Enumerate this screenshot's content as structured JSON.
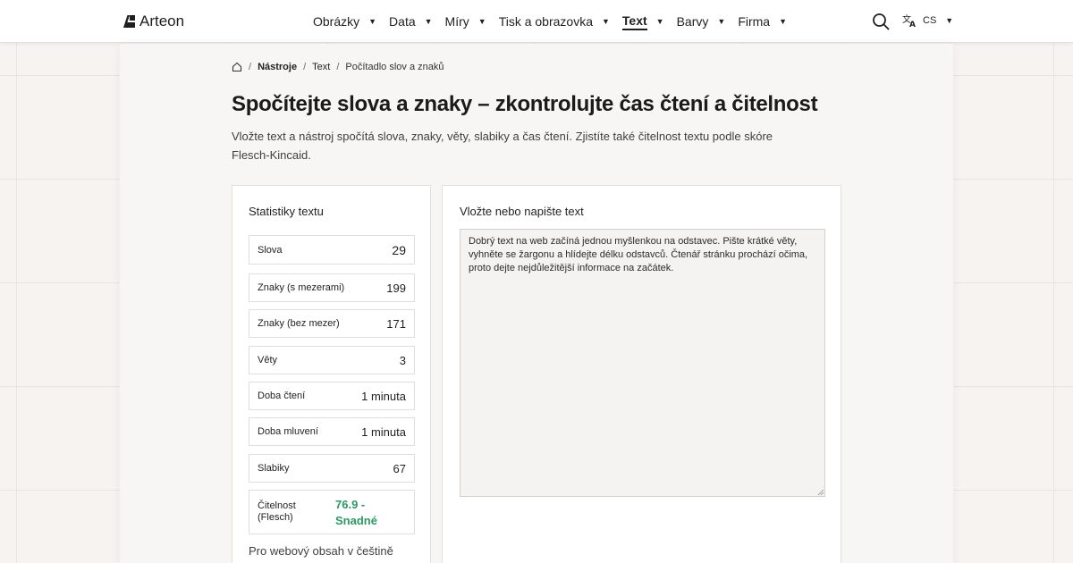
{
  "header": {
    "brand": "Arteon",
    "nav": [
      {
        "label": "Obrázky",
        "active": false
      },
      {
        "label": "Data",
        "active": false
      },
      {
        "label": "Míry",
        "active": false
      },
      {
        "label": "Tisk a obrazovka",
        "active": false
      },
      {
        "label": "Text",
        "active": true
      },
      {
        "label": "Barvy",
        "active": false
      },
      {
        "label": "Firma",
        "active": false
      }
    ],
    "caret": "▼",
    "search_icon": "search-icon",
    "language": {
      "icon": "translate-icon",
      "code": "CS"
    }
  },
  "breadcrumb": {
    "home_icon": "home-icon",
    "separator": "/",
    "items": [
      "Nástroje",
      "Text",
      "Počítadlo slov a znaků"
    ]
  },
  "page": {
    "title": "Spočítejte slova a znaky – zkontrolujte čas čtení a čitelnost",
    "description": "Vložte text a nástroj spočítá slova, znaky, věty, slabiky a čas čtení. Zjistíte také čitelnost textu podle skóre Flesch-Kincaid."
  },
  "stats": {
    "heading": "Statistiky textu",
    "rows": [
      {
        "label": "Slova",
        "value": "29"
      },
      {
        "label": "Znaky (s mezerami)",
        "value": "199"
      },
      {
        "label": "Znaky (bez mezer)",
        "value": "171"
      },
      {
        "label": "Věty",
        "value": "3"
      },
      {
        "label": "Doba čtení",
        "value": "1 minuta"
      },
      {
        "label": "Doba mluvení",
        "value": "1 minuta"
      },
      {
        "label": "Slabiky",
        "value": "67"
      }
    ],
    "readability": {
      "label": "Čitelnost (Flesch)",
      "value": "76.9 - Snadné"
    },
    "note": "Pro webový obsah v češtině"
  },
  "editor": {
    "heading": "Vložte nebo napište text",
    "text": "Dobrý text na web začíná jednou myšlenkou na odstavec. Pište krátké věty, vyhněte se žargonu a hlídejte délku odstavců. Čtenář stránku prochází očima, proto dejte nejdůležitější informace na začátek."
  },
  "colors": {
    "accent_green": "#2a9a63",
    "background": "#f6f3f1",
    "text": "#1f1f1f"
  }
}
